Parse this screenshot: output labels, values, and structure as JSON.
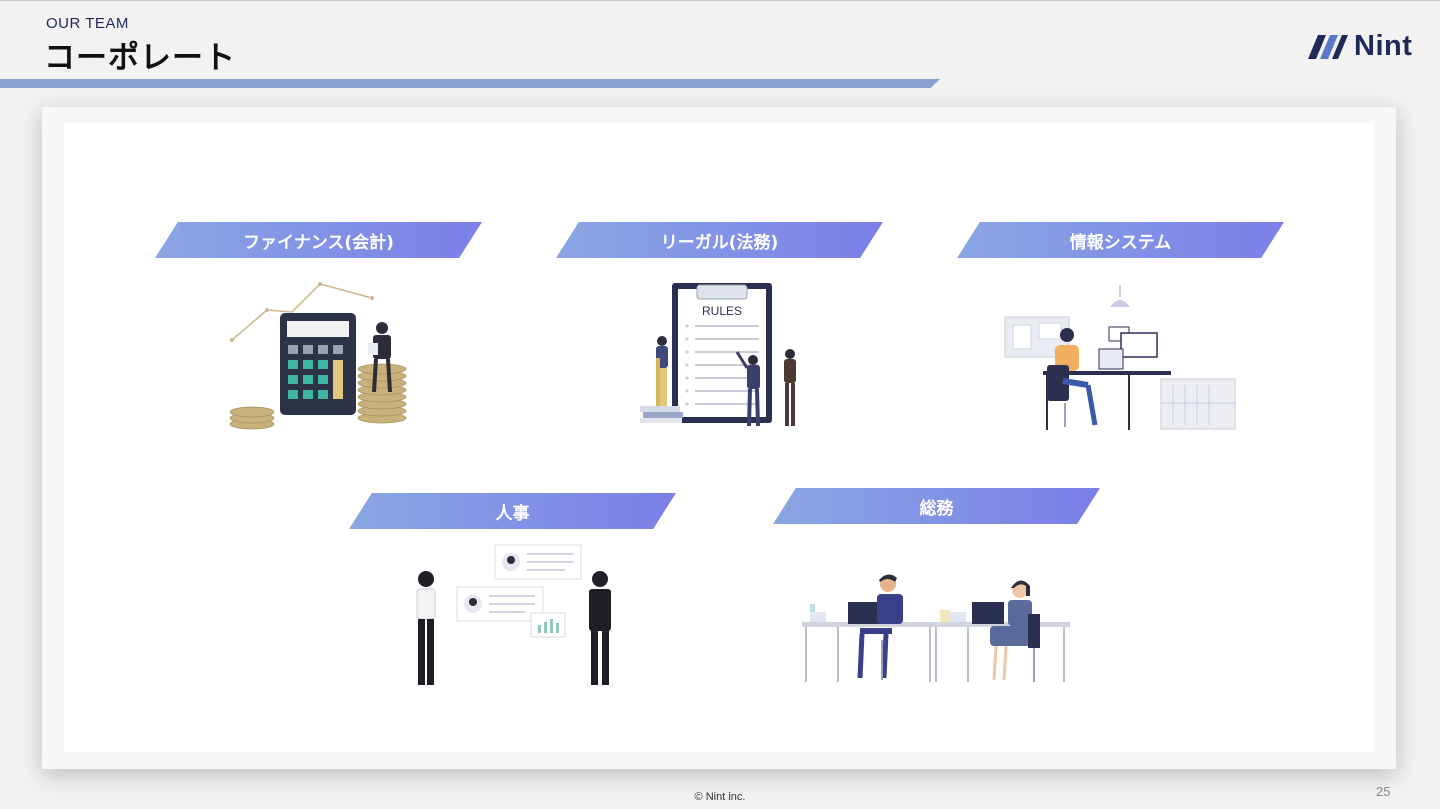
{
  "header": {
    "eyebrow": "OUR TEAM",
    "title": "コーポレート",
    "logo_text": "Nint"
  },
  "teams": [
    {
      "label": "ファイナンス(会計)",
      "icon": "calculator-coins-illustration"
    },
    {
      "label": "リーガル(法務)",
      "icon": "rules-clipboard-illustration",
      "board_text": "RULES"
    },
    {
      "label": "情報システム",
      "icon": "it-workstation-illustration"
    },
    {
      "label": "人事",
      "icon": "hr-profiles-illustration"
    },
    {
      "label": "総務",
      "icon": "office-desks-illustration"
    }
  ],
  "footer": {
    "copyright": "© Nint inc.",
    "page_number": "25"
  },
  "colors": {
    "banner_start": "#8aa6e3",
    "banner_end": "#7b7fe8",
    "rule": "#8aa0d0",
    "navy": "#1e2a55"
  }
}
